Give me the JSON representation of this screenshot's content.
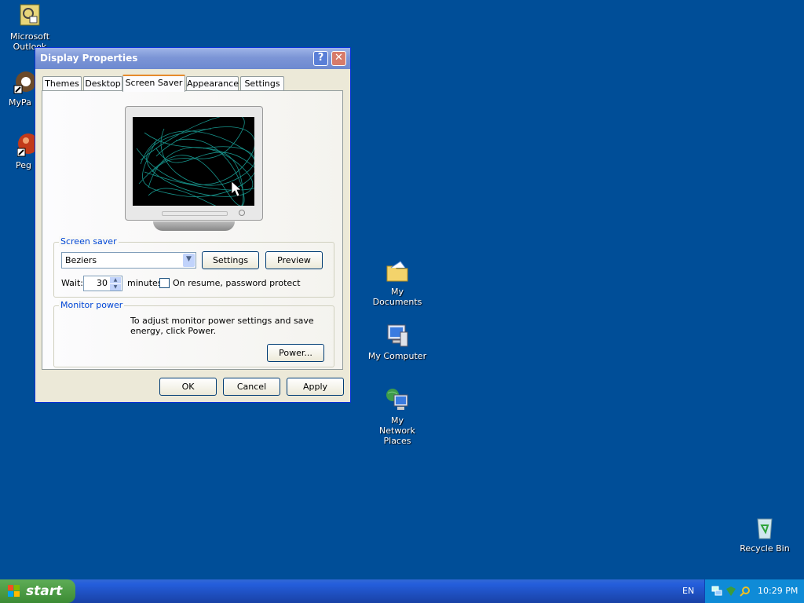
{
  "desktop_icons": [
    {
      "label": "Microsoft Outlook",
      "icon": "outlook-icon"
    },
    {
      "label": "MyPa",
      "icon": "shortcut-icon"
    },
    {
      "label": "Peg",
      "icon": "shortcut-icon"
    },
    {
      "label": "My Documents",
      "icon": "folder-icon"
    },
    {
      "label": "My Computer",
      "icon": "computer-icon"
    },
    {
      "label": "My Network Places",
      "icon": "network-icon"
    },
    {
      "label": "Recycle Bin",
      "icon": "recycle-bin-icon"
    }
  ],
  "window": {
    "title": "Display Properties",
    "help_glyph": "?",
    "close_glyph": "✕",
    "tabs": [
      "Themes",
      "Desktop",
      "Screen Saver",
      "Appearance",
      "Settings"
    ],
    "active_tab": "Screen Saver"
  },
  "screen_saver": {
    "group_label": "Screen saver",
    "selected": "Beziers",
    "settings_label": "Settings",
    "preview_label": "Preview",
    "wait_label": "Wait:",
    "wait_value": "30",
    "minutes_label": "minutes",
    "password_label": "On resume, password protect",
    "password_checked": false
  },
  "monitor_power": {
    "group_label": "Monitor power",
    "description": "To adjust monitor power settings and save energy, click Power.",
    "power_label": "Power..."
  },
  "dialog_buttons": {
    "ok": "OK",
    "cancel": "Cancel",
    "apply": "Apply"
  },
  "taskbar": {
    "start_label": "start",
    "language": "EN",
    "clock": "10:29 PM"
  },
  "colors": {
    "desktop": "#004e98",
    "accent_tab": "#e68b2c",
    "preview_curve": "#1aa39a"
  }
}
